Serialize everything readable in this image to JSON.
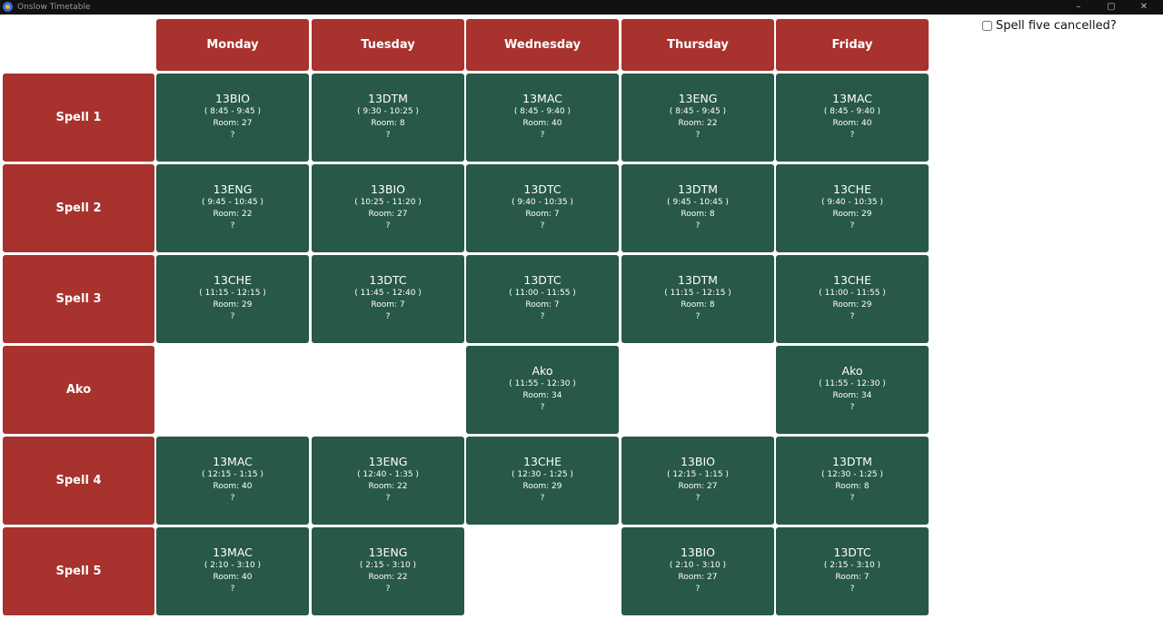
{
  "window": {
    "title": "Onslow Timetable",
    "controls": {
      "minimize": "–",
      "maximize": "▢",
      "close": "✕"
    }
  },
  "days": [
    "Monday",
    "Tuesday",
    "Wednesday",
    "Thursday",
    "Friday"
  ],
  "spell_toggle": {
    "label": "Spell five cancelled?",
    "checked": false
  },
  "colors": {
    "header": "#a8322d",
    "cell": "#285846",
    "titlebar": "#111111"
  },
  "rows": [
    {
      "label": "Spell 1",
      "cells": [
        {
          "subject": "13BIO",
          "time": "( 8:45 - 9:45 )",
          "room": "Room: 27",
          "note": "?"
        },
        {
          "subject": "13DTM",
          "time": "( 9:30 - 10:25 )",
          "room": "Room: 8",
          "note": "?"
        },
        {
          "subject": "13MAC",
          "time": "( 8:45 - 9:40 )",
          "room": "Room: 40",
          "note": "?"
        },
        {
          "subject": "13ENG",
          "time": "( 8:45 - 9:45 )",
          "room": "Room: 22",
          "note": "?"
        },
        {
          "subject": "13MAC",
          "time": "( 8:45 - 9:40 )",
          "room": "Room: 40",
          "note": "?"
        }
      ]
    },
    {
      "label": "Spell 2",
      "cells": [
        {
          "subject": "13ENG",
          "time": "( 9:45 - 10:45 )",
          "room": "Room: 22",
          "note": "?"
        },
        {
          "subject": "13BIO",
          "time": "( 10:25 - 11:20 )",
          "room": "Room: 27",
          "note": "?"
        },
        {
          "subject": "13DTC",
          "time": "( 9:40 - 10:35 )",
          "room": "Room: 7",
          "note": "?"
        },
        {
          "subject": "13DTM",
          "time": "( 9:45 - 10:45 )",
          "room": "Room: 8",
          "note": "?"
        },
        {
          "subject": "13CHE",
          "time": "( 9:40 - 10:35 )",
          "room": "Room: 29",
          "note": "?"
        }
      ]
    },
    {
      "label": "Spell 3",
      "cells": [
        {
          "subject": "13CHE",
          "time": "( 11:15 - 12:15 )",
          "room": "Room: 29",
          "note": "?"
        },
        {
          "subject": "13DTC",
          "time": "( 11:45 - 12:40 )",
          "room": "Room: 7",
          "note": "?"
        },
        {
          "subject": "13DTC",
          "time": "( 11:00 - 11:55 )",
          "room": "Room: 7",
          "note": "?"
        },
        {
          "subject": "13DTM",
          "time": "( 11:15 - 12:15 )",
          "room": "Room: 8",
          "note": "?"
        },
        {
          "subject": "13CHE",
          "time": "( 11:00 - 11:55 )",
          "room": "Room: 29",
          "note": "?"
        }
      ]
    },
    {
      "label": "Ako",
      "cells": [
        null,
        null,
        {
          "subject": "Ako",
          "time": "( 11:55 - 12:30 )",
          "room": "Room: 34",
          "note": "?"
        },
        null,
        {
          "subject": "Ako",
          "time": "( 11:55 - 12:30 )",
          "room": "Room: 34",
          "note": "?"
        }
      ]
    },
    {
      "label": "Spell 4",
      "cells": [
        {
          "subject": "13MAC",
          "time": "( 12:15 - 1:15 )",
          "room": "Room: 40",
          "note": "?"
        },
        {
          "subject": "13ENG",
          "time": "( 12:40 - 1:35 )",
          "room": "Room: 22",
          "note": "?"
        },
        {
          "subject": "13CHE",
          "time": "( 12:30 - 1:25 )",
          "room": "Room: 29",
          "note": "?"
        },
        {
          "subject": "13BIO",
          "time": "( 12:15 - 1:15 )",
          "room": "Room: 27",
          "note": "?"
        },
        {
          "subject": "13DTM",
          "time": "( 12:30 - 1:25 )",
          "room": "Room: 8",
          "note": "?"
        }
      ]
    },
    {
      "label": "Spell 5",
      "cells": [
        {
          "subject": "13MAC",
          "time": "( 2:10 - 3:10 )",
          "room": "Room: 40",
          "note": "?"
        },
        {
          "subject": "13ENG",
          "time": "( 2:15 - 3:10 )",
          "room": "Room: 22",
          "note": "?"
        },
        null,
        {
          "subject": "13BIO",
          "time": "( 2:10 - 3:10 )",
          "room": "Room: 27",
          "note": "?"
        },
        {
          "subject": "13DTC",
          "time": "( 2:15 - 3:10 )",
          "room": "Room: 7",
          "note": "?"
        }
      ]
    }
  ]
}
